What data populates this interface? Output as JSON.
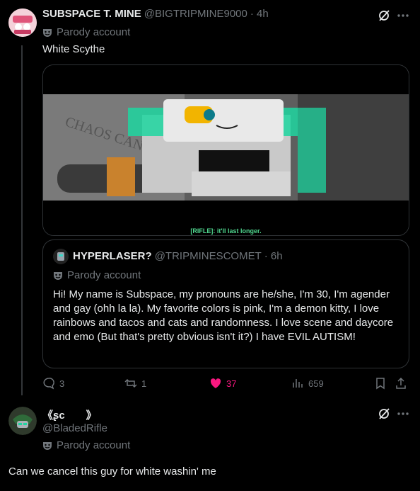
{
  "post": {
    "display_name": "SUBSPACE T. MINE",
    "handle": "@BIGTRIPMINE9000",
    "time": "· 4h",
    "parody_label": "Parody account",
    "text": "White Scythe",
    "media_caption": "[RIFLE]: it'll last longer.",
    "quote": {
      "display_name": "HYPERLASER?",
      "handle": "@TRIPMINESCOMET",
      "time": "· 6h",
      "parody_label": "Parody account",
      "text": "Hi! My name is Subspace, my pronouns are he/she, I'm 30, I'm agender and gay (ohh la la). My favorite colors is pink, I'm a demon kitty, I love rainbows and tacos and cats and randomness. I love scene and daycore and emo (But that's pretty obvious isn't it?) I have EVIL AUTISM!"
    },
    "actions": {
      "replies": "3",
      "reposts": "1",
      "likes": "37",
      "views": "659"
    }
  },
  "reply": {
    "display_name": "《ʂc　　》",
    "handle": "@BladedRifle",
    "parody_label": "Parody account",
    "text": "Can we cancel this guy for white washin' me"
  },
  "colors": {
    "background": "#000000",
    "text": "#e7e9ea",
    "muted": "#71767b",
    "like": "#f91880",
    "caption": "#50d890"
  }
}
